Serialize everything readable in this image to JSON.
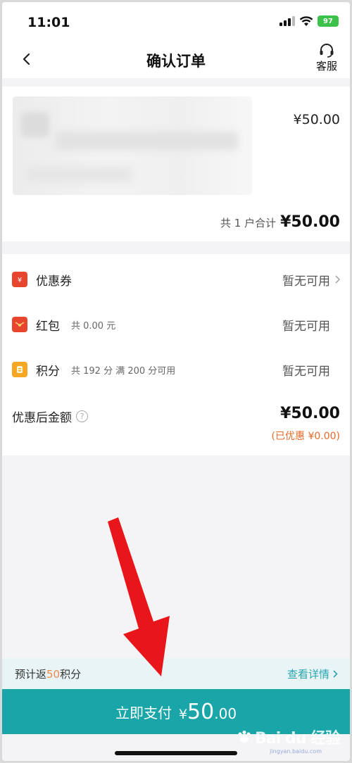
{
  "status_bar": {
    "time": "11:01",
    "battery": "97"
  },
  "nav": {
    "title": "确认订单",
    "service_label": "客服"
  },
  "product": {
    "price": "¥50.00",
    "total_label": "共 1 户合计",
    "total_value": "¥50.00"
  },
  "discounts": {
    "items": [
      {
        "title": "优惠券",
        "sub": "",
        "status": "暂无可用",
        "icon": "coupon-icon",
        "color": "#e8452f"
      },
      {
        "title": "红包",
        "sub": "共 0.00 元",
        "status": "暂无可用",
        "icon": "red-packet-icon",
        "color": "#e8452f"
      },
      {
        "title": "积分",
        "sub": "共 192 分  满 200 分可用",
        "status": "暂无可用",
        "icon": "points-icon",
        "color": "#f5a623"
      }
    ],
    "final_label": "优惠后金额",
    "final_amount": "¥50.00",
    "saved_note": "(已优惠 ¥0.00)"
  },
  "points_bar": {
    "prefix": "预计返",
    "points": "50",
    "suffix": "积分",
    "details_label": "查看详情"
  },
  "pay": {
    "label": "立即支付",
    "currency": "¥",
    "amount_int": "50",
    "amount_dec": ".00"
  },
  "watermark": {
    "text": "Bai du 经验",
    "sub": "jingyan.baidu.com"
  }
}
